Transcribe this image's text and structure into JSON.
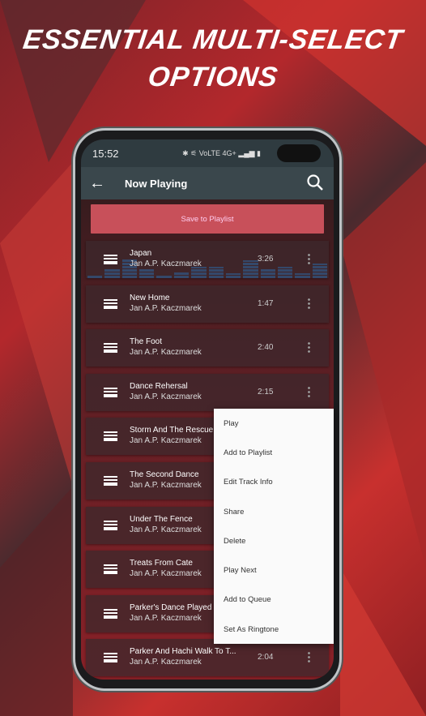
{
  "headline": {
    "line1": "ESSENTIAL MULTI-SELECT",
    "line2": "OPTIONS"
  },
  "status": {
    "time": "15:52",
    "icons": "✱ ⚟ VoLTE 4G+ ▂▄▆ ▮"
  },
  "appbar": {
    "title": "Now Playing",
    "back_icon": "arrow-left",
    "search_icon": "search"
  },
  "save_label": "Save to Playlist",
  "tracks": [
    {
      "title": "Japan",
      "artist": "Jan A.P. Kaczmarek",
      "duration": "3:26",
      "playing": true
    },
    {
      "title": "New Home",
      "artist": "Jan A.P. Kaczmarek",
      "duration": "1:47"
    },
    {
      "title": "The Foot",
      "artist": "Jan A.P. Kaczmarek",
      "duration": "2:40"
    },
    {
      "title": "Dance Rehersal",
      "artist": "Jan A.P. Kaczmarek",
      "duration": "2:15"
    },
    {
      "title": "Storm And The Rescue",
      "artist": "Jan A.P. Kaczmarek",
      "duration": ""
    },
    {
      "title": "The Second Dance",
      "artist": "Jan A.P. Kaczmarek",
      "duration": ""
    },
    {
      "title": "Under The Fence",
      "artist": "Jan A.P. Kaczmarek",
      "duration": ""
    },
    {
      "title": "Treats From Cate",
      "artist": "Jan A.P. Kaczmarek",
      "duration": ""
    },
    {
      "title": "Parker's Dance Played",
      "artist": "Jan A.P. Kaczmarek",
      "duration": ""
    },
    {
      "title": "Parker And Hachi Walk To T...",
      "artist": "Jan A.P. Kaczmarek",
      "duration": "2:04"
    }
  ],
  "menu": [
    "Play",
    "Add to Playlist",
    "Edit Track Info",
    "Share",
    "Delete",
    "Play Next",
    "Add to Queue",
    "Set As Ringtone"
  ],
  "colors": {
    "accent": "#c8505a",
    "appbar": "#3a474c"
  }
}
